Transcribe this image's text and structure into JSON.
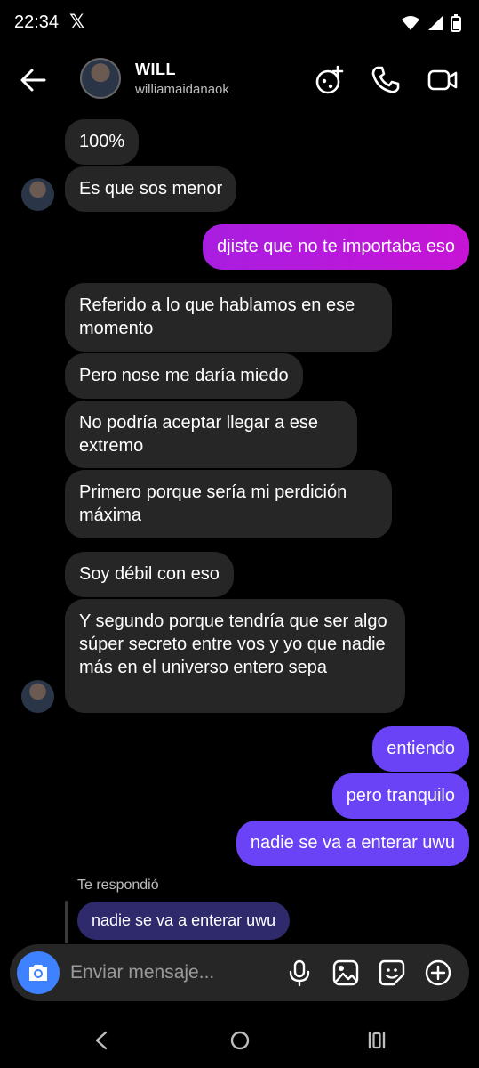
{
  "status_bar": {
    "time": "22:34"
  },
  "header": {
    "name": "WILL",
    "username": "williamaidanaok"
  },
  "messages": {
    "m1": "100%",
    "m2": "Es que sos menor",
    "m3": "djiste que no te importaba eso",
    "m4": "Referido a lo que hablamos en ese momento",
    "m5": "Pero nose me daría miedo",
    "m6": "No podría aceptar llegar a ese extremo",
    "m7": "Primero porque sería mi perdición máxima",
    "m8": "Soy débil con eso",
    "m9": "Y segundo porque tendría que ser algo súper secreto entre vos y yo que nadie más en el universo entero sepa",
    "m10": "entiendo",
    "m11": "pero tranquilo",
    "m12": "nadie se va a enterar uwu"
  },
  "reply": {
    "label": "Te respondió",
    "text": "nadie se va a enterar uwu"
  },
  "composer": {
    "placeholder": "Enviar mensaje..."
  },
  "colors": {
    "sent": "#6943f5",
    "sent_gradient_start": "#a81ee0",
    "received": "#262626",
    "camera": "#3f82ff"
  }
}
